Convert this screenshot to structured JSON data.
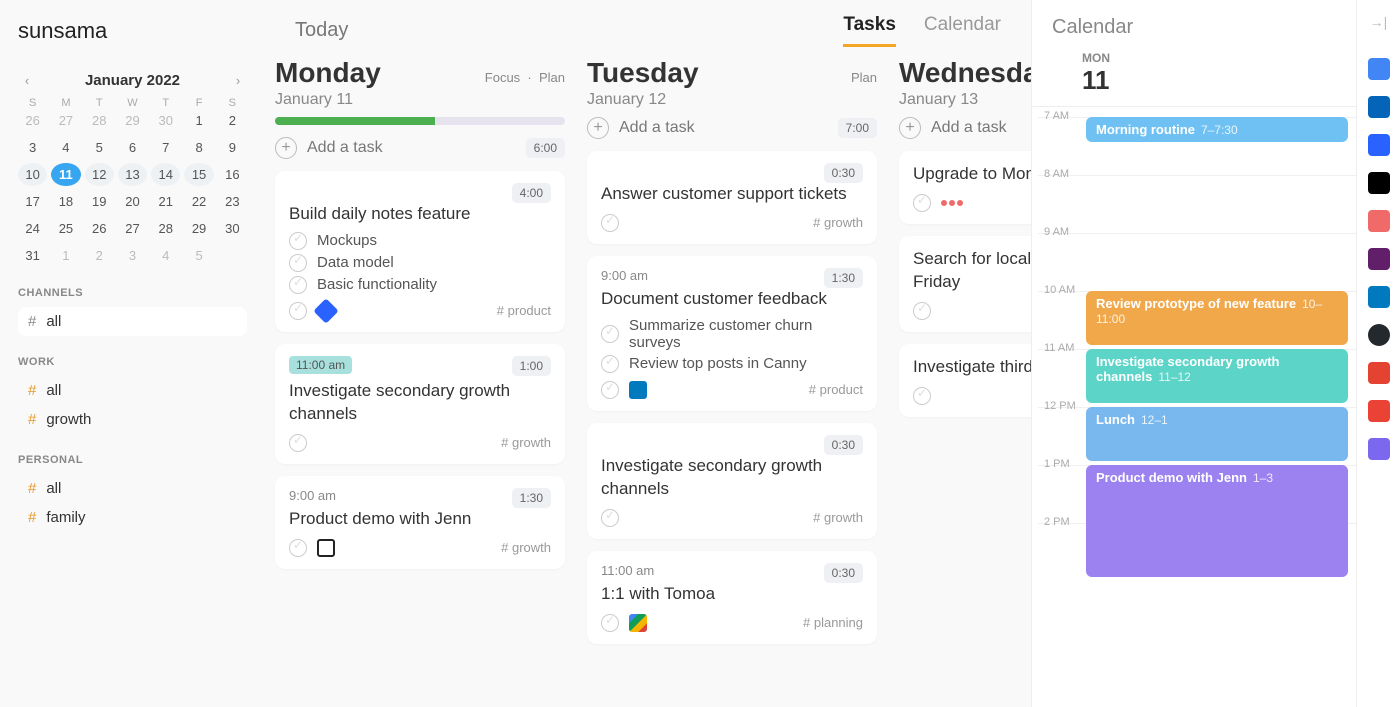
{
  "brand": "sunsama",
  "header": {
    "today_label": "Today",
    "tabs": {
      "tasks": "Tasks",
      "calendar": "Calendar"
    }
  },
  "minical": {
    "title": "January 2022",
    "dow": [
      "S",
      "M",
      "T",
      "W",
      "T",
      "F",
      "S"
    ],
    "days": [
      {
        "n": "26",
        "muted": true
      },
      {
        "n": "27",
        "muted": true
      },
      {
        "n": "28",
        "muted": true
      },
      {
        "n": "29",
        "muted": true
      },
      {
        "n": "30",
        "muted": true
      },
      {
        "n": "1"
      },
      {
        "n": "2"
      },
      {
        "n": "3"
      },
      {
        "n": "4"
      },
      {
        "n": "5"
      },
      {
        "n": "6"
      },
      {
        "n": "7"
      },
      {
        "n": "8"
      },
      {
        "n": "9"
      },
      {
        "n": "10",
        "week": true
      },
      {
        "n": "11",
        "today": true
      },
      {
        "n": "12",
        "week": true
      },
      {
        "n": "13",
        "week": true
      },
      {
        "n": "14",
        "week": true
      },
      {
        "n": "15",
        "week": true
      },
      {
        "n": "16"
      },
      {
        "n": "17"
      },
      {
        "n": "18"
      },
      {
        "n": "19"
      },
      {
        "n": "20"
      },
      {
        "n": "21"
      },
      {
        "n": "22"
      },
      {
        "n": "23"
      },
      {
        "n": "24"
      },
      {
        "n": "25"
      },
      {
        "n": "26"
      },
      {
        "n": "27"
      },
      {
        "n": "28"
      },
      {
        "n": "29"
      },
      {
        "n": "30"
      },
      {
        "n": "31"
      },
      {
        "n": "1",
        "muted": true
      },
      {
        "n": "2",
        "muted": true
      },
      {
        "n": "3",
        "muted": true
      },
      {
        "n": "4",
        "muted": true
      },
      {
        "n": "5",
        "muted": true
      }
    ]
  },
  "channels": {
    "section_label": "CHANNELS",
    "all": "all",
    "work_label": "WORK",
    "work": [
      "all",
      "growth"
    ],
    "personal_label": "PERSONAL",
    "personal": [
      "all",
      "family"
    ]
  },
  "columns": [
    {
      "day": "Monday",
      "date": "January 11",
      "links": [
        "Focus",
        "Plan"
      ],
      "progress": 55,
      "add_label": "Add a task",
      "total": "6:00",
      "cards": [
        {
          "title": "Build daily notes feature",
          "dur": "4:00",
          "subtasks": [
            "Mockups",
            "Data model",
            "Basic functionality"
          ],
          "icon": "jira",
          "tag": "# product"
        },
        {
          "title": "Investigate secondary growth channels",
          "dur": "1:00",
          "timechip": "11:00 am",
          "tag": "# growth"
        },
        {
          "title": "Product demo with Jenn",
          "dur": "1:30",
          "timeplain": "9:00 am",
          "icon": "notion",
          "tag": "# growth"
        }
      ]
    },
    {
      "day": "Tuesday",
      "date": "January 12",
      "links": [
        "Plan"
      ],
      "add_label": "Add a task",
      "total": "7:00",
      "cards": [
        {
          "title": "Answer customer support tickets",
          "dur": "0:30",
          "tag": "# growth"
        },
        {
          "title": "Document customer feedback",
          "dur": "1:30",
          "timeplain": "9:00 am",
          "subtasks": [
            "Summarize customer churn surveys",
            "Review top posts in Canny"
          ],
          "icon": "trello",
          "tag": "# product"
        },
        {
          "title": "Investigate secondary growth channels",
          "dur": "0:30",
          "tag": "# growth"
        },
        {
          "title": "1:1 with Tomoa",
          "dur": "0:30",
          "timeplain": "11:00 am",
          "icon": "gcal",
          "tag": "# planning"
        }
      ]
    },
    {
      "day": "Wednesday",
      "date": "January 13",
      "add_label": "Add a task",
      "cards": [
        {
          "title": "Upgrade to MongoDB",
          "icon": "asana"
        },
        {
          "title": "Search for local art shows on First Friday"
        },
        {
          "title": "Investigate third growth channels"
        }
      ]
    }
  ],
  "calpanel": {
    "title": "Calendar",
    "dow": "MON",
    "daynum": "11",
    "hours": [
      "7 AM",
      "8 AM",
      "9 AM",
      "10 AM",
      "11 AM",
      "12 PM",
      "1 PM",
      "2 PM"
    ],
    "hour_height": 58,
    "events": [
      {
        "title": "Morning routine",
        "time": "7–7:30",
        "start": 0,
        "span": 0.5,
        "color": "#6ec1f2"
      },
      {
        "title": "Review prototype of new feature",
        "time": "10–11:00",
        "start": 3,
        "span": 1,
        "color": "#f0a84b"
      },
      {
        "title": "Investigate secondary growth channels",
        "time": "11–12",
        "start": 4,
        "span": 1,
        "color": "#5cd4c8"
      },
      {
        "title": "Lunch",
        "time": "12–1",
        "start": 5,
        "span": 1,
        "color": "#78b8ef"
      },
      {
        "title": "Product demo with Jenn",
        "time": "1–3",
        "start": 6,
        "span": 2,
        "color": "#9b82f0"
      }
    ]
  },
  "rail_icons": [
    {
      "name": "google-calendar-icon",
      "color": "#4285F4"
    },
    {
      "name": "outlook-icon",
      "color": "#0364B8"
    },
    {
      "name": "jira-icon",
      "color": "#2962ff"
    },
    {
      "name": "notion-icon",
      "color": "#000"
    },
    {
      "name": "asana-icon",
      "color": "#f06a6a"
    },
    {
      "name": "slack-icon",
      "color": "#611f69"
    },
    {
      "name": "trello-icon",
      "color": "#0079bf"
    },
    {
      "name": "github-icon",
      "color": "#24292e"
    },
    {
      "name": "todoist-icon",
      "color": "#e44332"
    },
    {
      "name": "gmail-icon",
      "color": "#ea4335"
    },
    {
      "name": "clickup-icon",
      "color": "#7b68ee"
    }
  ]
}
